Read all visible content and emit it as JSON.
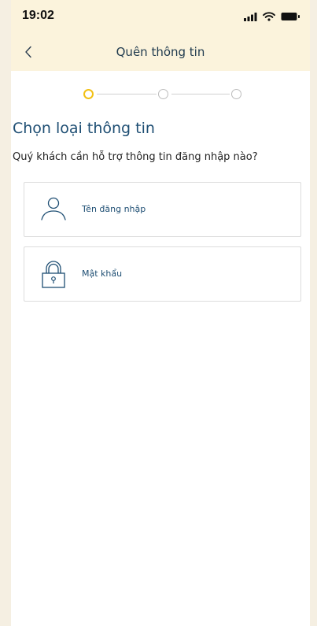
{
  "status_bar": {
    "time": "19:02",
    "icons": [
      "signal-icon",
      "wifi-icon",
      "battery-icon"
    ]
  },
  "nav": {
    "back_icon": "chevron-left-icon",
    "title": "Quên thông tin"
  },
  "stepper": {
    "total_steps": 3,
    "current_step": 1,
    "colors": {
      "active": "#f2c013",
      "inactive": "#bcbcbc"
    }
  },
  "main": {
    "heading": "Chọn loại thông tin",
    "subheading": "Quý khách cần hỗ trợ thông tin đăng nhập nào?",
    "options": [
      {
        "label": "Tên đăng nhập",
        "icon": "user-icon"
      },
      {
        "label": "Mật khẩu",
        "icon": "lock-icon"
      }
    ]
  },
  "colors": {
    "header_background": "#fbf3dc",
    "heading_text": "#1e4e73",
    "nav_title_text": "#1f3a4e"
  }
}
